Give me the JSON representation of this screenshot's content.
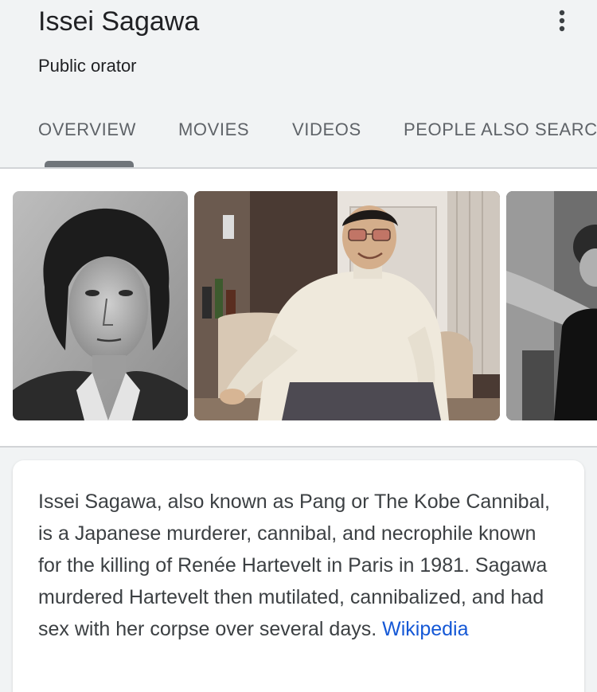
{
  "entity": {
    "title": "Issei Sagawa",
    "subtitle": "Public orator"
  },
  "tabs": [
    {
      "label": "OVERVIEW",
      "active": true
    },
    {
      "label": "MOVIES",
      "active": false
    },
    {
      "label": "VIDEOS",
      "active": false
    },
    {
      "label": "PEOPLE ALSO SEARCH FOR",
      "active": false
    }
  ],
  "icons": {
    "more": "more-vert-icon"
  },
  "images": [
    {
      "name": "portrait-photo"
    },
    {
      "name": "seated-photo"
    },
    {
      "name": "group-photo-partial"
    }
  ],
  "description": {
    "text": "Issei Sagawa, also known as Pang or The Kobe Cannibal, is a Japanese murderer, cannibal, and necrophile known for the killing of Renée Hartevelt in Paris in 1981. Sagawa murdered Hartevelt then mutilated, cannibalized, and had sex with her corpse over several days.",
    "source_label": "Wikipedia"
  },
  "colors": {
    "header_bg": "#f1f3f4",
    "link": "#1558d6",
    "text": "#3c4043",
    "tab_text": "#5f6368"
  }
}
